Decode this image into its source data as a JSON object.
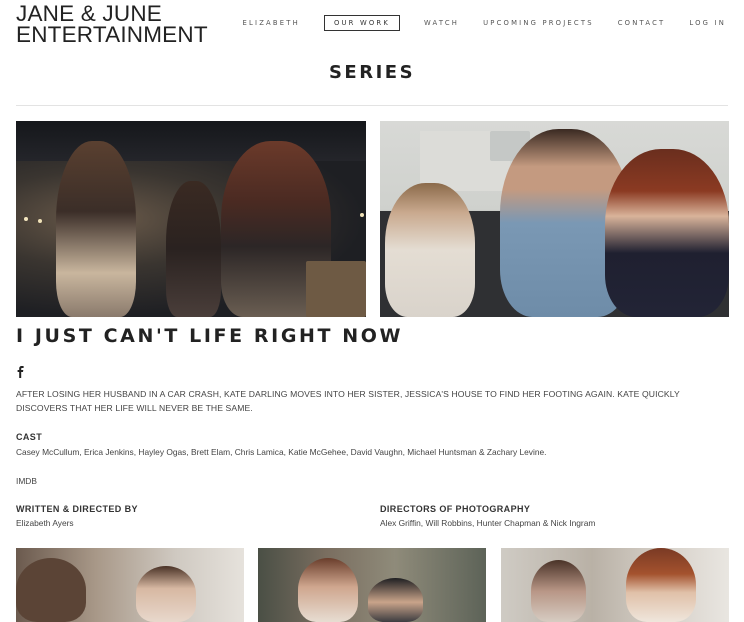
{
  "header": {
    "logo_line1": "JANE & JUNE",
    "logo_line2": "ENTERTAINMENT",
    "nav": [
      "ELIZABETH",
      "OUR WORK",
      "WATCH",
      "UPCOMING PROJECTS",
      "CONTACT",
      "LOG IN"
    ],
    "active_nav": "OUR WORK"
  },
  "main": {
    "section_title": "SERIES",
    "show_title": "I JUST CAN'T LIFE RIGHT NOW",
    "share_icon": "facebook-icon",
    "description": "AFTER LOSING HER HUSBAND IN A CAR CRASH, KATE DARLING MOVES INTO HER SISTER, JESSICA'S HOUSE TO FIND HER FOOTING AGAIN. KATE QUICKLY DISCOVERS THAT HER LIFE WILL NEVER BE THE SAME.",
    "cast_label": "CAST",
    "cast": "Casey McCullum, Erica Jenkins, Hayley Ogas, Brett Elam, Chris Lamica, Katie McGehee, David Vaughn, Michael Huntsman & Zachary Levine.",
    "imdb_link": "IMDB",
    "written_label": "WRITTEN & DIRECTED BY",
    "written_by": "Elizabeth Ayers",
    "dp_label": "DIRECTORS OF PHOTOGRAPHY",
    "dp_names": "Alex Griffin, Will Robbins, Hunter Chapman & Nick Ingram"
  },
  "colors": {
    "text": "#333333",
    "divider": "#e3e3e3",
    "background": "#ffffff"
  }
}
